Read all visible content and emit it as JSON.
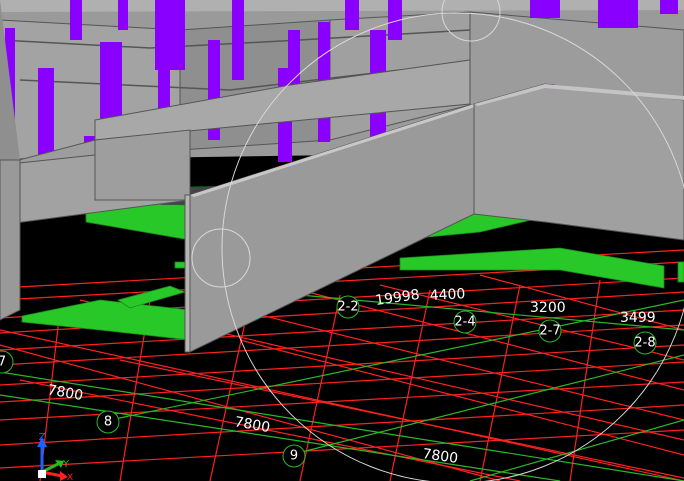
{
  "viewport": {
    "dimension_labels": [
      "19998",
      "4400",
      "3200",
      "3499",
      "7800",
      "7800",
      "7800"
    ],
    "axis_tags": [
      "2-2",
      "2-4",
      "2-7",
      "2-8",
      "7",
      "8",
      "9"
    ]
  },
  "ucs_icon": {
    "axis_z": "Z",
    "axis_y": "Y",
    "axis_x": "X"
  },
  "colors": {
    "background": "#000000",
    "wall": "#9a9a9a",
    "wall_top": "#b8b8b8",
    "column": "#8a00ff",
    "beam": "#28c828",
    "grid_red": "#ff2020",
    "grid_green": "#2ab82a"
  }
}
